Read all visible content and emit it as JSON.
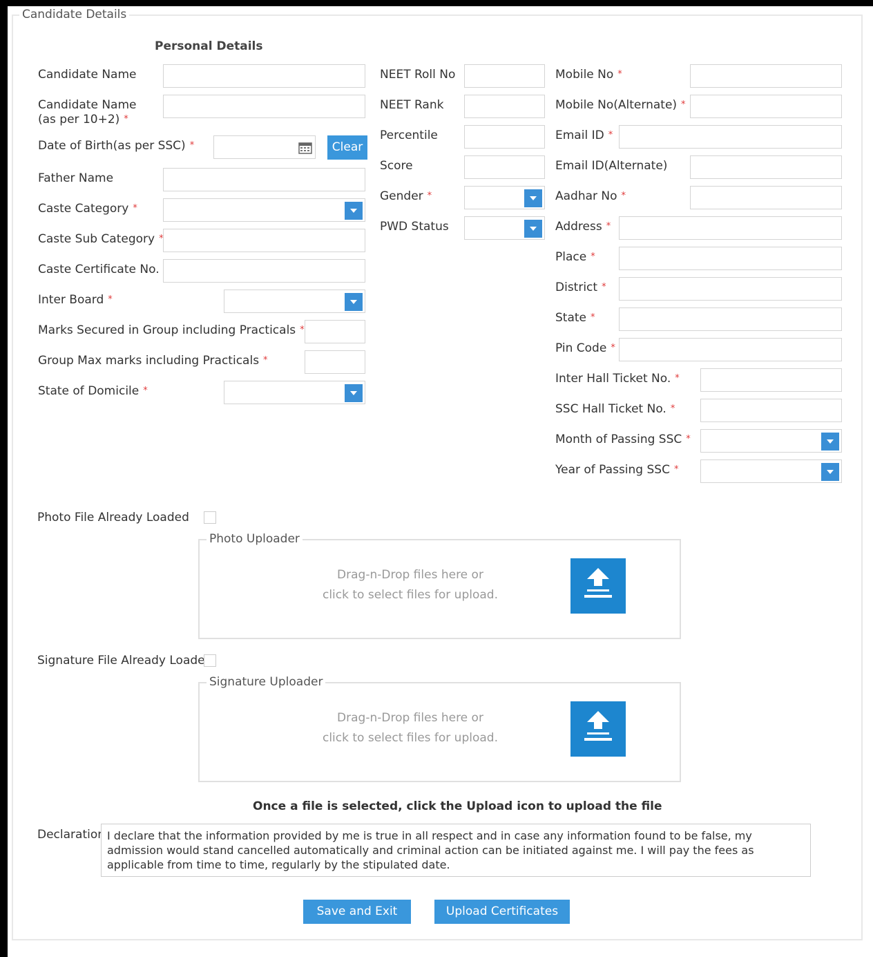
{
  "section": {
    "legend": "Candidate Details",
    "personal_heading": "Personal Details"
  },
  "left": {
    "candidate_name": "Candidate Name",
    "candidate_name_ssc_line1": "Candidate Name",
    "candidate_name_ssc_line2": "(as per 10+2)",
    "dob": "Date of Birth(as per SSC)",
    "clear": "Clear",
    "father_name": "Father Name",
    "caste_category": "Caste Category",
    "caste_sub_category": "Caste Sub Category",
    "caste_certificate": "Caste Certificate No.",
    "inter_board": "Inter Board",
    "marks_secured": "Marks Secured in Group including Practicals",
    "group_max": "Group Max marks including Practicals",
    "state_domicile": "State of Domicile"
  },
  "middle": {
    "neet_roll": "NEET Roll No",
    "neet_rank": "NEET Rank",
    "percentile": "Percentile",
    "score": "Score",
    "gender": "Gender",
    "pwd_status": "PWD Status"
  },
  "right": {
    "mobile": "Mobile No",
    "mobile_alt": "Mobile No(Alternate)",
    "email": "Email ID",
    "email_alt": "Email ID(Alternate)",
    "aadhar": "Aadhar No",
    "address": "Address",
    "place": "Place",
    "district": "District",
    "state": "State",
    "pin": "Pin Code",
    "inter_hall": "Inter Hall Ticket No.",
    "ssc_hall": "SSC Hall Ticket No.",
    "month_ssc": "Month of Passing SSC",
    "year_ssc": "Year of Passing SSC"
  },
  "required_mark": "*",
  "photo": {
    "already_loaded": "Photo File Already Loaded",
    "uploader_legend": "Photo Uploader",
    "hint1": "Drag-n-Drop files here or",
    "hint2": "click to select files for upload."
  },
  "signature": {
    "already_loaded": "Signature File Already Loaded",
    "uploader_legend": "Signature Uploader",
    "hint1": "Drag-n-Drop files here or",
    "hint2": "click to select files for upload."
  },
  "upload_note": "Once a file is selected, click the Upload icon to upload the file",
  "declaration": {
    "label": "Declaration",
    "text": "I declare that the information provided by me is true in all respect and in case any information found to be false, my admission would stand cancelled automatically and criminal action can be initiated against me. I will pay the fees as applicable from time to time, regularly by the stipulated date."
  },
  "actions": {
    "save_exit": "Save and Exit",
    "upload_certificates": "Upload Certificates"
  },
  "icons": {
    "calendar": "calendar-icon",
    "upload": "upload-icon",
    "dropdown": "chevron-down-icon"
  },
  "colors": {
    "accent": "#3a97dc",
    "required": "#e03a3a",
    "upload_tile": "#1d86cf"
  }
}
